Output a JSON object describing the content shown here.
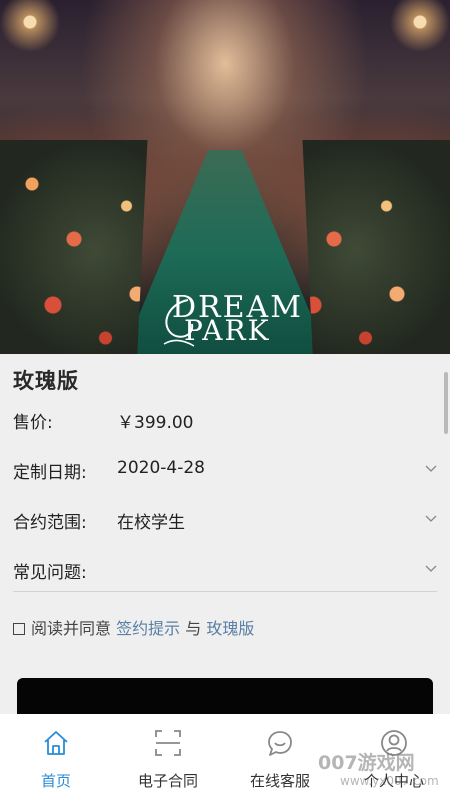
{
  "hero": {
    "logo_line1": "DREAM",
    "logo_line2": "PARK"
  },
  "product": {
    "title": "玫瑰版",
    "price_label": "售价:",
    "price_value": "￥399.00",
    "date_label": "定制日期:",
    "date_value": "2020-4-28",
    "scope_label": "合约范围:",
    "scope_value": "在校学生",
    "faq_label": "常见问题:"
  },
  "agreement": {
    "prefix": "阅读并同意",
    "link1": "签约提示",
    "joiner": "与",
    "link2": "玫瑰版"
  },
  "tabs": [
    {
      "label": "首页",
      "icon": "home-icon",
      "active": true
    },
    {
      "label": "电子合同",
      "icon": "scan-icon",
      "active": false
    },
    {
      "label": "在线客服",
      "icon": "chat-icon",
      "active": false
    },
    {
      "label": "个人中心",
      "icon": "user-icon",
      "active": false
    }
  ],
  "watermark": {
    "line1": "007游戏网",
    "line2": "www.yx007.com"
  },
  "colors": {
    "accent": "#2a8bd6",
    "link": "#5a7fa6",
    "background": "#efefef"
  }
}
